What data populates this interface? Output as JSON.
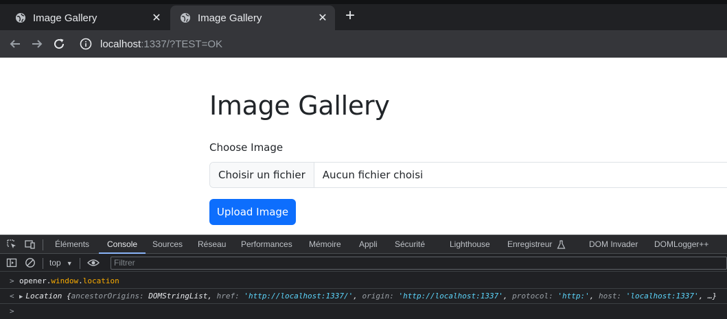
{
  "browser": {
    "tabs": [
      {
        "title": "Image Gallery",
        "icon": "globe-icon",
        "active": false
      },
      {
        "title": "Image Gallery",
        "icon": "globe-icon",
        "active": true
      }
    ],
    "close_glyph": "✕",
    "new_tab_glyph": "+",
    "address": {
      "host": "localhost",
      "rest": ":1337/?TEST=OK"
    }
  },
  "page": {
    "title": "Image Gallery",
    "field_label": "Choose Image",
    "file_button": "Choisir un fichier",
    "file_status": "Aucun fichier choisi",
    "upload_button": "Upload Image",
    "accent_color": "#0d6efd"
  },
  "devtools": {
    "tabs": [
      "Éléments",
      "Console",
      "Sources",
      "Réseau",
      "Performances",
      "Mémoire",
      "Appli",
      "Sécurité",
      "Lighthouse",
      "Enregistreur",
      "DOM Invader",
      "DOMLogger++"
    ],
    "active_tab": "Console",
    "context": "top",
    "filter_placeholder": "Filtrer",
    "console": {
      "input_prompt": ">",
      "input_parts": [
        "opener",
        ".",
        "window",
        ".",
        "location"
      ],
      "output_prompt": "<",
      "output": {
        "class_name": "Location",
        "open": "{",
        "entries": [
          {
            "key": "ancestorOrigins",
            "value": "DOMStringList"
          },
          {
            "key": "href",
            "value": "'http://localhost:1337/'"
          },
          {
            "key": "origin",
            "value": "'http://localhost:1337'"
          },
          {
            "key": "protocol",
            "value": "'http:'"
          },
          {
            "key": "host",
            "value": "'localhost:1337'"
          }
        ],
        "ellipsis": "…}"
      },
      "next_prompt": ">"
    }
  }
}
